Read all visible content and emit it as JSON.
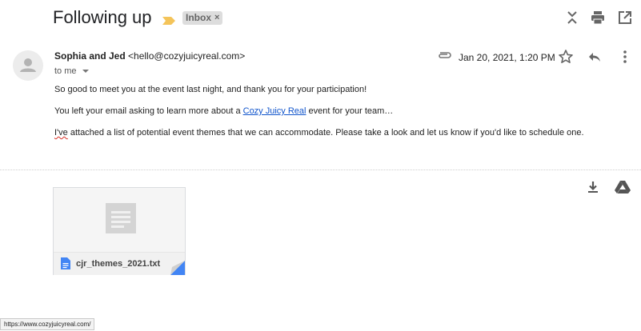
{
  "email": {
    "subject": "Following up",
    "label": "Inbox",
    "label_remove": "×",
    "sender_name": "Sophia and Jed",
    "sender_email": "<hello@cozyjuicyreal.com>",
    "recipient": "to me",
    "date": "Jan 20, 2021, 1:20 PM",
    "body": {
      "line1": "So good to meet you at the event last night, and thank you for your participation!",
      "line2_before": "You left your email asking to learn more about a ",
      "line2_link": "Cozy Juicy Real",
      "line2_after": " event for your team…",
      "line3_word": "I've",
      "line3_rest": " attached a list of potential event themes that we can accommodate. Please take a look and let us know if you'd like to schedule one."
    }
  },
  "attachment": {
    "filename": "cjr_themes_2021.txt"
  },
  "status_url": "https://www.cozyjuicyreal.com/",
  "icons": {
    "importance": "importance-marker-icon",
    "toggle": "expand-collapse-icon",
    "print": "print-icon",
    "open": "open-in-new-window-icon",
    "avatar": "person-icon",
    "attachment": "paperclip-icon",
    "star": "star-icon",
    "reply": "reply-icon",
    "more": "more-vert-icon",
    "download": "download-icon",
    "drive": "drive-icon",
    "file": "doc-file-icon"
  },
  "colors": {
    "link": "#1155cc",
    "importance": "#f4c45a",
    "label_bg": "#dddddd",
    "doc_blue": "#4285f4"
  }
}
